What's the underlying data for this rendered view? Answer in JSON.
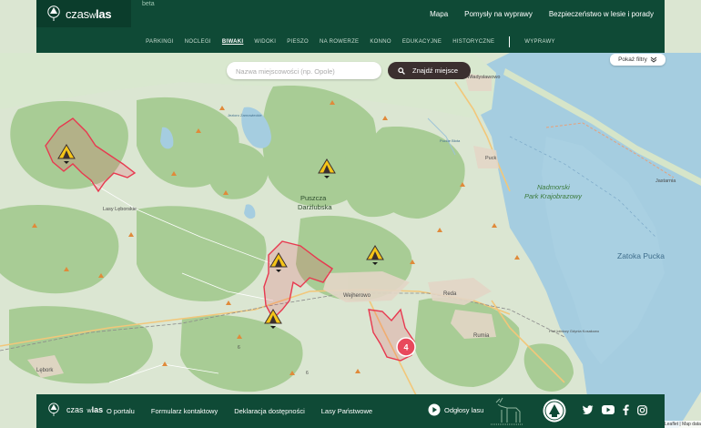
{
  "brand": {
    "name_light": "czas",
    "name_small": "w",
    "name_bold": "las",
    "badge": "beta"
  },
  "topnav": [
    "Mapa",
    "Pomysły na wyprawy",
    "Bezpieczeństwo w lesie i porady"
  ],
  "subnav": {
    "items": [
      "Parkingi",
      "Noclegi",
      "Biwaki",
      "Widoki",
      "Pieszo",
      "Na rowerze",
      "Konno",
      "Edukacyjne",
      "Historyczne"
    ],
    "active": "Biwaki",
    "extra": "Wyprawy"
  },
  "search": {
    "placeholder": "Nazwa miejscowości (np. Opole)",
    "button_label": "Znajdź miejsce"
  },
  "filters_label": "Pokaż filtry",
  "map": {
    "places": [
      "Władysławowo",
      "Puck",
      "Jastarnia",
      "Nadmorski",
      "Park Krajobrazowy",
      "Zatoka Pucka",
      "Puszcza",
      "Darżlubska",
      "Lasy Lęborskie",
      "Wejherowo",
      "Reda",
      "Rumia",
      "Lębork",
      "Port lotniczy Gdynia Kosakowo",
      "Puckie Błota",
      "Jezioro Żarnowieckie"
    ],
    "road_labels": [
      "6",
      "6"
    ],
    "cluster_count": "4",
    "attribution": "Leaflet | Map data ©"
  },
  "footer": {
    "brand": {
      "name_light": "czas",
      "name_small": "w",
      "name_bold": "las"
    },
    "links": [
      "O portalu",
      "Formularz kontaktowy",
      "Deklaracja dostępności",
      "Lasy Państwowe"
    ],
    "odglosy": "Odgłosy lasu"
  },
  "colors": {
    "header": "#0f4a36",
    "forest": "#a8cc95",
    "water": "#a5cde0",
    "area_outline": "#e8384f",
    "search_button": "#3b2f2f"
  },
  "icons": [
    "logo-shield-icon",
    "search-icon",
    "chevron-down-icon",
    "camp-marker-icon",
    "cluster-marker",
    "play-icon",
    "deer-icon",
    "lasy-panstwowe-logo-icon",
    "twitter-icon",
    "youtube-icon",
    "facebook-icon",
    "instagram-icon"
  ]
}
